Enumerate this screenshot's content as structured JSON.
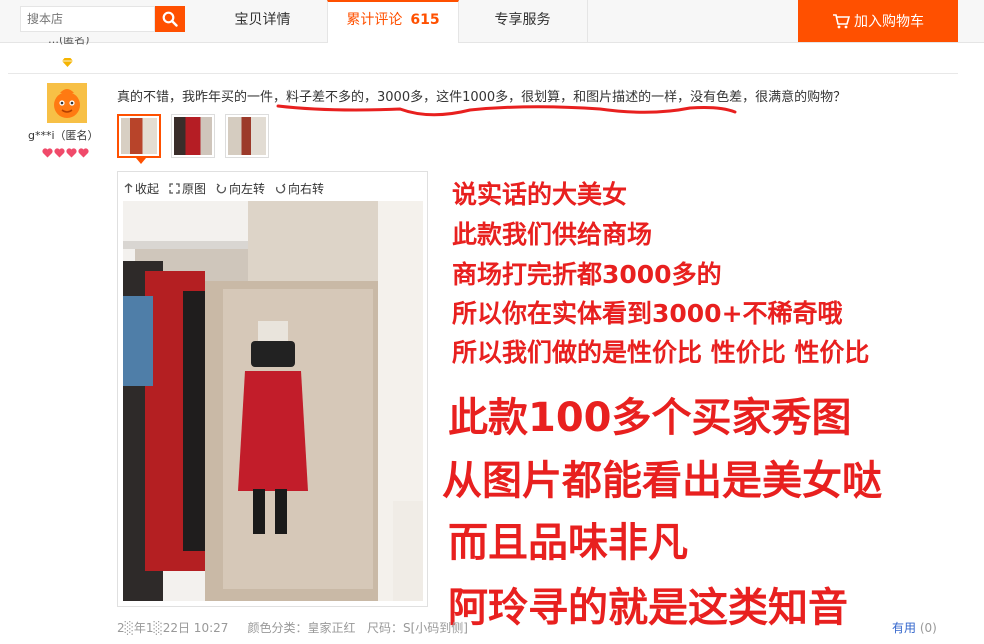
{
  "search": {
    "placeholder": "搜本店"
  },
  "tabs": [
    {
      "label": "宝贝详情"
    },
    {
      "label": "累计评论",
      "count": "615"
    },
    {
      "label": "专享服务"
    }
  ],
  "cart": {
    "label": "加入购物车"
  },
  "prev_review": {
    "name": "…(匿名)"
  },
  "review": {
    "username": "g***i（匿名）",
    "text": "真的不错，我昨年买的一件，料子差不多的，3000多，这件1000多，很划算，和图片描述的一样，没有色差，很满意的购物？",
    "viewer_tools": [
      "收起",
      "原图",
      "向左转",
      "向右转"
    ],
    "date": "2░年1░22日 10:27",
    "color_label": "颜色分类：皇家正红",
    "size_label": "尺码：S[小码到侧]",
    "useful_label": "有用",
    "useful_count": "(0)"
  },
  "overlay_lines": [
    "说实话的大美女",
    "此款我们供给商场",
    "商场打完折都3000多的",
    "所以你在实体看到3000+不稀奇哦",
    "所以我们做的是性价比  性价比 性价比",
    "此款100多个买家秀图",
    "从图片都能看出是美女哒",
    "而且品味非凡",
    "阿玲寻的就是这类知音"
  ],
  "colors": {
    "accent": "#ff5000",
    "overlay": "#e8201f"
  },
  "icons": [
    "search-icon",
    "cart-icon",
    "gem-icon",
    "heart-icon",
    "collapse-icon",
    "fullsize-icon",
    "rotate-left-icon",
    "rotate-right-icon"
  ]
}
